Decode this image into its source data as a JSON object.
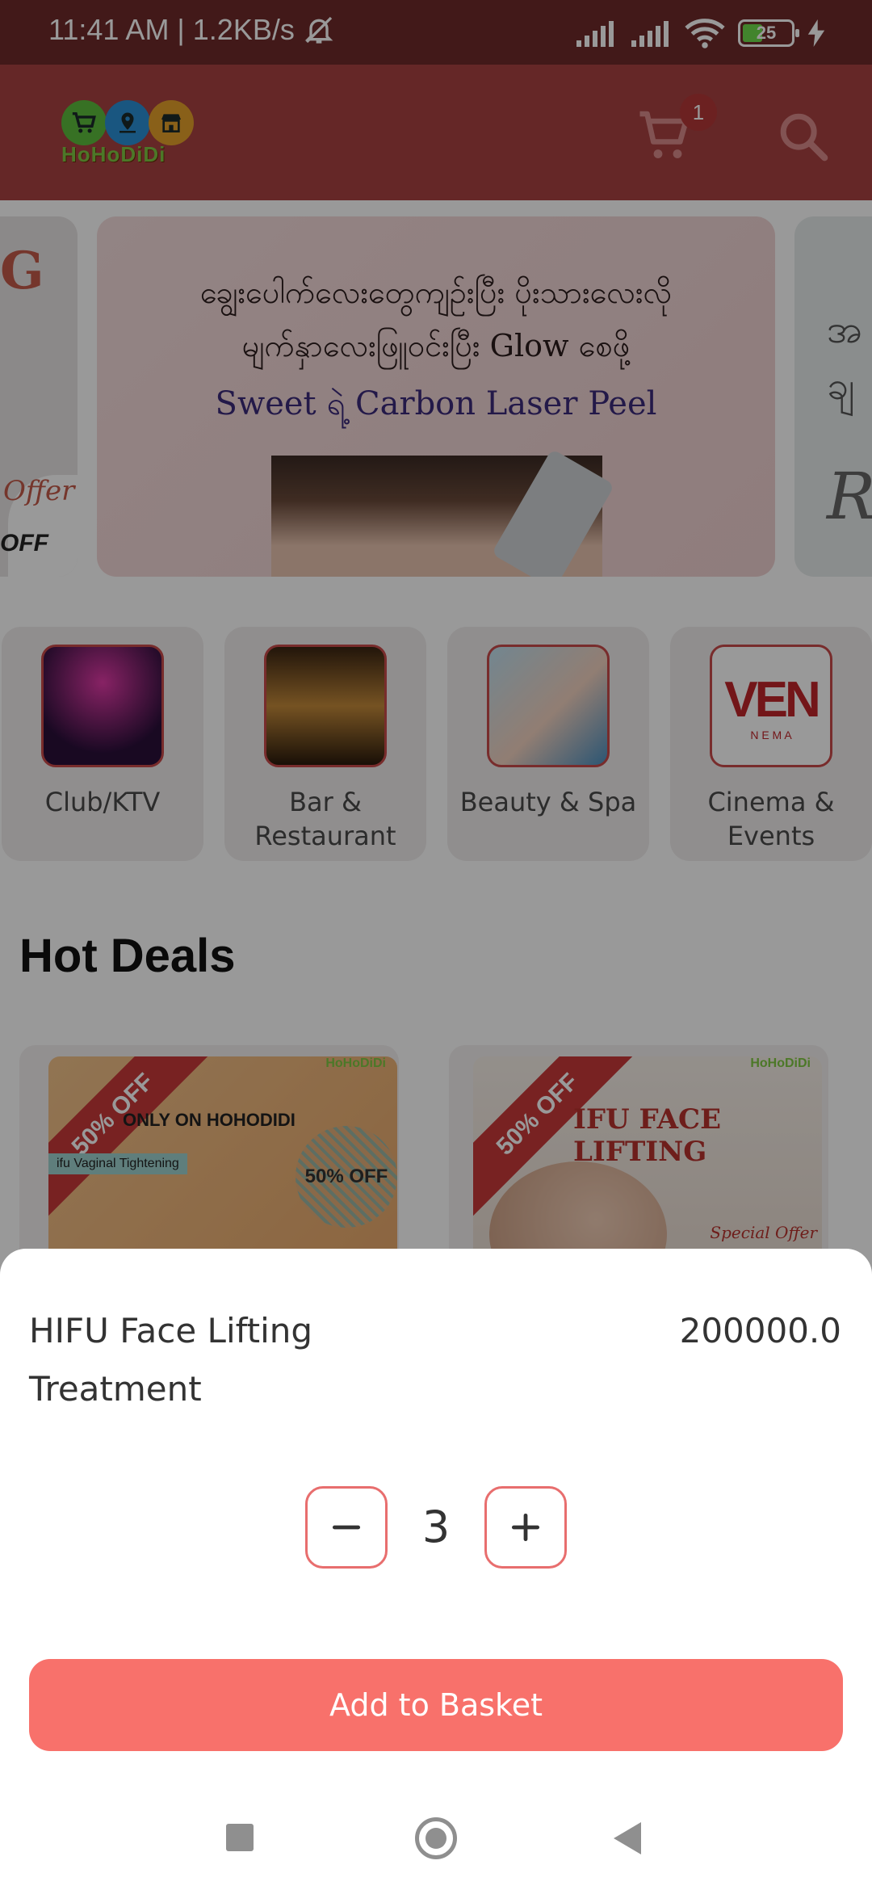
{
  "status_bar": {
    "time_speed": "11:41 AM | 1.2KB/s",
    "battery": "25",
    "icons": [
      "bell-off-icon",
      "signal-icon",
      "signal-icon",
      "wifi-icon",
      "battery-icon",
      "charging-icon"
    ]
  },
  "app_bar": {
    "logo_text": "HoHoDiDi",
    "cart_count": "1",
    "icons": [
      "cart-icon",
      "search-icon"
    ]
  },
  "banner": {
    "line1": "ချွေးပေါက်လေးတွေကျဉ်းပြီး ပိုးသားလေးလို",
    "line2": "မျက်နှာလေးဖြူဝင်းပြီး Glow စေဖို့",
    "line3": "Sweet ရဲ့ Carbon Laser Peel",
    "left_partial": [
      "G",
      "Offer",
      "OFF"
    ],
    "right_partial": [
      "အ",
      "ချ",
      "R"
    ]
  },
  "categories": [
    {
      "label": "Club/KTV"
    },
    {
      "label": "Bar & Restaurant"
    },
    {
      "label": "Beauty & Spa"
    },
    {
      "label": "Cinema & Events",
      "logo": "VEN",
      "logo_sub": "N E M A"
    }
  ],
  "section_title": "Hot Deals",
  "deals": [
    {
      "ribbon": "50% OFF",
      "title": "ONLY ON HOHODIDI",
      "tag": "ifu Vaginal Tightening",
      "badge": "50% OFF",
      "watermark": "HoHoDiDi"
    },
    {
      "ribbon": "50% OFF",
      "title": "IFU FACE LIFTING",
      "badge": "Special Offer",
      "watermark": "HoHoDiDi"
    }
  ],
  "sheet": {
    "product_name": "HIFU Face Lifting Treatment",
    "price": "200000.0",
    "quantity": "3",
    "add_label": "Add to Basket"
  },
  "colors": {
    "status_bar": "#6e2b2b",
    "app_bar": "#a84141",
    "accent": "#f8716b",
    "stepper_border": "#e86e6e"
  }
}
